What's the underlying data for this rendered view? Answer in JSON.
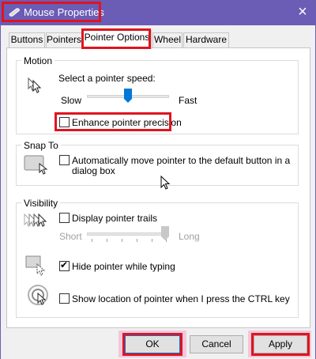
{
  "window": {
    "title": "Mouse Properties",
    "close_icon": "×"
  },
  "tabs": [
    {
      "label": "Buttons"
    },
    {
      "label": "Pointers"
    },
    {
      "label": "Pointer Options",
      "active": true
    },
    {
      "label": "Wheel"
    },
    {
      "label": "Hardware"
    }
  ],
  "motion": {
    "group_label": "Motion",
    "speed_label": "Select a pointer speed:",
    "slow_label": "Slow",
    "fast_label": "Fast",
    "speed_fraction": 0.5,
    "enhance_label": "Enhance pointer precision",
    "enhance_checked": false
  },
  "snap": {
    "group_label": "Snap To",
    "auto_label_line1": "Automatically move pointer to the default button in a",
    "auto_label_line2": "dialog box",
    "auto_checked": false
  },
  "visibility": {
    "group_label": "Visibility",
    "trails_label": "Display pointer trails",
    "trails_checked": false,
    "short_label": "Short",
    "long_label": "Long",
    "trails_fraction": 1.0,
    "hide_label": "Hide pointer while typing",
    "hide_checked": true,
    "show_ctrl_label": "Show location of pointer when I press the CTRL key",
    "show_ctrl_checked": false,
    "check_mark": "✔"
  },
  "buttons": {
    "ok": "OK",
    "cancel": "Cancel",
    "apply": "Apply"
  },
  "colors": {
    "title_bar": "#6b5cb6",
    "highlight": "#e0141e",
    "accent": "#0078d7"
  }
}
